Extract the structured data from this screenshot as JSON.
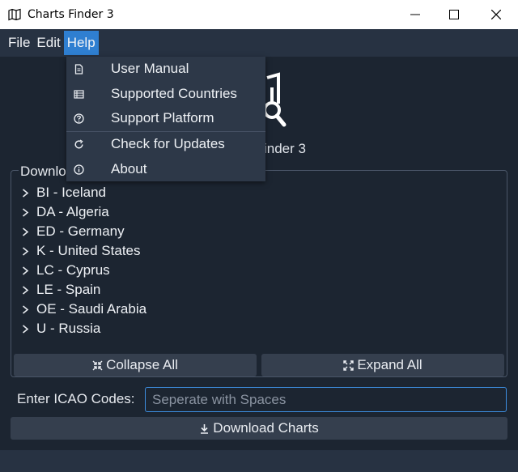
{
  "window": {
    "title": "Charts Finder 3",
    "icon": "map-icon"
  },
  "menubar": {
    "items": [
      "File",
      "Edit",
      "Help"
    ],
    "active": "Help"
  },
  "help_menu": {
    "items": [
      {
        "label": "User Manual",
        "icon": "document-icon"
      },
      {
        "label": "Supported Countries",
        "icon": "list-icon"
      },
      {
        "label": "Support Platform",
        "icon": "help-circle-icon"
      },
      {
        "label": "Check for Updates",
        "icon": "refresh-icon"
      },
      {
        "label": "About",
        "icon": "info-icon"
      }
    ]
  },
  "logo": {
    "text_visible": "inder 3"
  },
  "downloads": {
    "group_title_visible": "Downlo",
    "items": [
      "BI - Iceland",
      "DA - Algeria",
      "ED - Germany",
      "K - United States",
      "LC - Cyprus",
      "LE - Spain",
      "OE - Saudi Arabia",
      "U - Russia"
    ],
    "collapse_label": "Collapse All",
    "expand_label": "Expand All"
  },
  "icao": {
    "label": "Enter ICAO Codes:",
    "placeholder": "Seperate with Spaces",
    "value": ""
  },
  "download_button": {
    "label": "Download Charts"
  },
  "colors": {
    "background": "#1c2531",
    "menubar": "#273242",
    "accent": "#2f7fd1",
    "button": "#353f4e",
    "dropdown": "#2d3848"
  }
}
